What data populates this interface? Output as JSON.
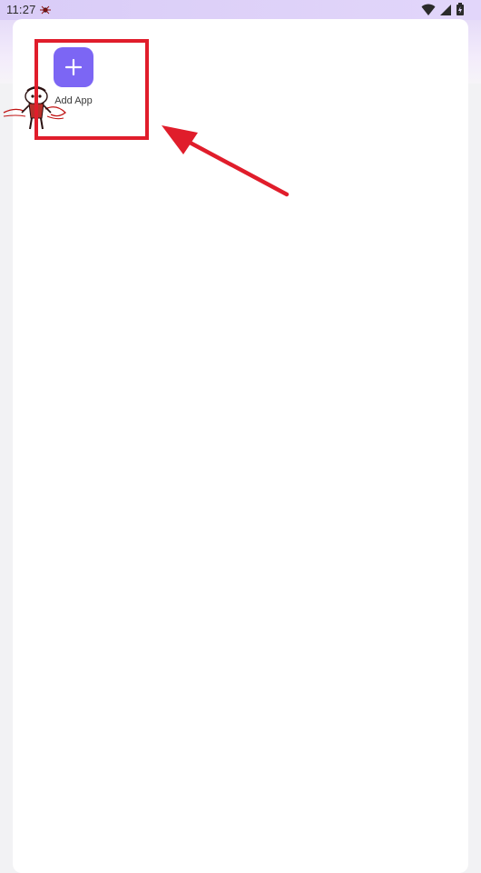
{
  "status_bar": {
    "time": "11:27"
  },
  "home": {
    "add_app_label": "Add App"
  },
  "icons": {
    "add": "plus-icon",
    "notification": "bug-notification-icon",
    "wifi": "wifi-icon",
    "signal": "signal-icon",
    "battery": "battery-icon"
  },
  "colors": {
    "accent": "#7c66f4",
    "annotation": "#e01d2b",
    "status_bar": "#d9ccf7"
  }
}
